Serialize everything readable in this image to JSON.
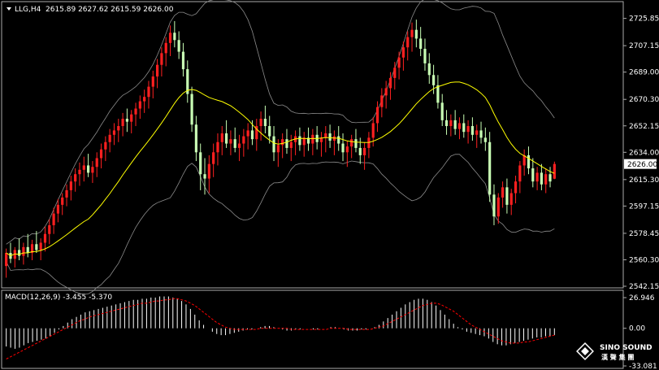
{
  "colors": {
    "background": "#000000",
    "bull": "#ff2020",
    "bear": "#c8ffb4",
    "ma": "#ffff00",
    "band": "#8c8c8c",
    "macd_hist": "#ffffff",
    "macd_signal": "#ff0000",
    "text": "#ffffff"
  },
  "header": {
    "symbol": "LLG,H4",
    "ohlc": "2615.89 2627.62 2615.59 2626.00",
    "menu_icon": "triangle-down-icon"
  },
  "price_axis": {
    "ticks": [
      "2725.85",
      "2707.15",
      "2689.00",
      "2670.30",
      "2652.15",
      "2634.00",
      "2615.30",
      "2597.15",
      "2578.45",
      "2560.30",
      "2542.15"
    ],
    "current_price": "2626.00"
  },
  "macd": {
    "label": "MACD(12,26,9) -3.455 -5.370",
    "ticks": [
      "26.946",
      "0.00",
      "-33.081"
    ]
  },
  "watermark": {
    "brand": "SINO SOUND",
    "chinese": "漢 聲 集 團",
    "icon": "sino-sound-diamond-icon"
  },
  "chart_data": {
    "type": "candlestick",
    "title": "LLG,H4",
    "ylim": [
      2542.15,
      2734
    ],
    "candles": [
      [
        2556,
        2568,
        2548,
        2565
      ],
      [
        2565,
        2572,
        2558,
        2561
      ],
      [
        2561,
        2569,
        2555,
        2567
      ],
      [
        2567,
        2575,
        2560,
        2563
      ],
      [
        2563,
        2572,
        2557,
        2569
      ],
      [
        2569,
        2578,
        2562,
        2565
      ],
      [
        2565,
        2574,
        2560,
        2571
      ],
      [
        2571,
        2580,
        2565,
        2567
      ],
      [
        2567,
        2575,
        2560,
        2572
      ],
      [
        2572,
        2583,
        2566,
        2578
      ],
      [
        2578,
        2588,
        2571,
        2584
      ],
      [
        2584,
        2596,
        2578,
        2592
      ],
      [
        2592,
        2602,
        2586,
        2598
      ],
      [
        2598,
        2606,
        2591,
        2603
      ],
      [
        2603,
        2612,
        2597,
        2608
      ],
      [
        2608,
        2618,
        2601,
        2614
      ],
      [
        2614,
        2623,
        2607,
        2619
      ],
      [
        2619,
        2627,
        2611,
        2622
      ],
      [
        2622,
        2631,
        2614,
        2625
      ],
      [
        2625,
        2633,
        2617,
        2620
      ],
      [
        2620,
        2628,
        2613,
        2624
      ],
      [
        2624,
        2634,
        2617,
        2630
      ],
      [
        2630,
        2640,
        2623,
        2636
      ],
      [
        2636,
        2645,
        2628,
        2641
      ],
      [
        2641,
        2650,
        2634,
        2646
      ],
      [
        2646,
        2654,
        2639,
        2649
      ],
      [
        2649,
        2657,
        2641,
        2652
      ],
      [
        2652,
        2661,
        2645,
        2657
      ],
      [
        2657,
        2664,
        2648,
        2655
      ],
      [
        2655,
        2663,
        2647,
        2660
      ],
      [
        2660,
        2668,
        2652,
        2664
      ],
      [
        2664,
        2673,
        2657,
        2669
      ],
      [
        2669,
        2677,
        2661,
        2672
      ],
      [
        2672,
        2683,
        2664,
        2679
      ],
      [
        2679,
        2690,
        2671,
        2686
      ],
      [
        2686,
        2698,
        2678,
        2694
      ],
      [
        2694,
        2706,
        2686,
        2702
      ],
      [
        2702,
        2713,
        2693,
        2709
      ],
      [
        2709,
        2721,
        2700,
        2716
      ],
      [
        2716,
        2724,
        2706,
        2711
      ],
      [
        2711,
        2717,
        2698,
        2703
      ],
      [
        2703,
        2709,
        2686,
        2691
      ],
      [
        2691,
        2697,
        2668,
        2674
      ],
      [
        2674,
        2679,
        2648,
        2653
      ],
      [
        2653,
        2659,
        2628,
        2634
      ],
      [
        2634,
        2640,
        2608,
        2619
      ],
      [
        2619,
        2630,
        2605,
        2616
      ],
      [
        2616,
        2632,
        2606,
        2626
      ],
      [
        2626,
        2640,
        2617,
        2634
      ],
      [
        2634,
        2647,
        2625,
        2641
      ],
      [
        2641,
        2652,
        2632,
        2647
      ],
      [
        2647,
        2656,
        2637,
        2640
      ],
      [
        2640,
        2649,
        2632,
        2643
      ],
      [
        2643,
        2651,
        2634,
        2637
      ],
      [
        2637,
        2646,
        2628,
        2640
      ],
      [
        2640,
        2650,
        2631,
        2645
      ],
      [
        2645,
        2654,
        2636,
        2649
      ],
      [
        2649,
        2656,
        2639,
        2643
      ],
      [
        2643,
        2657,
        2635,
        2652
      ],
      [
        2652,
        2662,
        2642,
        2657
      ],
      [
        2657,
        2666,
        2647,
        2652
      ],
      [
        2652,
        2659,
        2640,
        2645
      ],
      [
        2645,
        2652,
        2628,
        2634
      ],
      [
        2634,
        2643,
        2624,
        2639
      ],
      [
        2639,
        2647,
        2630,
        2643
      ],
      [
        2643,
        2650,
        2633,
        2637
      ],
      [
        2637,
        2646,
        2628,
        2641
      ],
      [
        2641,
        2649,
        2632,
        2645
      ],
      [
        2645,
        2651,
        2635,
        2639
      ],
      [
        2639,
        2648,
        2631,
        2644
      ],
      [
        2644,
        2651,
        2635,
        2640
      ],
      [
        2640,
        2650,
        2632,
        2646
      ],
      [
        2646,
        2652,
        2636,
        2641
      ],
      [
        2641,
        2648,
        2631,
        2644
      ],
      [
        2644,
        2652,
        2634,
        2647
      ],
      [
        2647,
        2653,
        2637,
        2642
      ],
      [
        2642,
        2649,
        2632,
        2645
      ],
      [
        2645,
        2652,
        2635,
        2640
      ],
      [
        2640,
        2647,
        2628,
        2634
      ],
      [
        2634,
        2642,
        2624,
        2638
      ],
      [
        2638,
        2646,
        2630,
        2643
      ],
      [
        2643,
        2650,
        2634,
        2637
      ],
      [
        2637,
        2644,
        2626,
        2632
      ],
      [
        2632,
        2641,
        2622,
        2637
      ],
      [
        2637,
        2648,
        2630,
        2644
      ],
      [
        2644,
        2658,
        2638,
        2654
      ],
      [
        2654,
        2669,
        2648,
        2665
      ],
      [
        2665,
        2678,
        2658,
        2673
      ],
      [
        2673,
        2683,
        2664,
        2678
      ],
      [
        2678,
        2689,
        2670,
        2685
      ],
      [
        2685,
        2696,
        2677,
        2692
      ],
      [
        2692,
        2703,
        2684,
        2699
      ],
      [
        2699,
        2710,
        2690,
        2706
      ],
      [
        2706,
        2717,
        2697,
        2713
      ],
      [
        2713,
        2723,
        2703,
        2718
      ],
      [
        2718,
        2725,
        2706,
        2712
      ],
      [
        2712,
        2720,
        2700,
        2705
      ],
      [
        2705,
        2712,
        2690,
        2695
      ],
      [
        2695,
        2702,
        2681,
        2687
      ],
      [
        2687,
        2694,
        2674,
        2680
      ],
      [
        2680,
        2687,
        2664,
        2668
      ],
      [
        2668,
        2674,
        2652,
        2656
      ],
      [
        2656,
        2663,
        2646,
        2652
      ],
      [
        2652,
        2660,
        2645,
        2656
      ],
      [
        2656,
        2663,
        2646,
        2650
      ],
      [
        2650,
        2658,
        2643,
        2654
      ],
      [
        2654,
        2660,
        2644,
        2648
      ],
      [
        2648,
        2656,
        2640,
        2652
      ],
      [
        2652,
        2658,
        2642,
        2646
      ],
      [
        2646,
        2653,
        2637,
        2649
      ],
      [
        2649,
        2655,
        2640,
        2644
      ],
      [
        2644,
        2651,
        2635,
        2641
      ],
      [
        2641,
        2648,
        2600,
        2605
      ],
      [
        2605,
        2612,
        2584,
        2590
      ],
      [
        2590,
        2606,
        2585,
        2603
      ],
      [
        2603,
        2614,
        2596,
        2610
      ],
      [
        2610,
        2616,
        2592,
        2598
      ],
      [
        2598,
        2609,
        2591,
        2606
      ],
      [
        2606,
        2618,
        2599,
        2614
      ],
      [
        2614,
        2628,
        2606,
        2625
      ],
      [
        2625,
        2636,
        2618,
        2632
      ],
      [
        2632,
        2638,
        2619,
        2623
      ],
      [
        2623,
        2630,
        2610,
        2614
      ],
      [
        2614,
        2624,
        2608,
        2620
      ],
      [
        2620,
        2626,
        2608,
        2612
      ],
      [
        2612,
        2623,
        2606,
        2619
      ],
      [
        2619,
        2624,
        2610,
        2614
      ],
      [
        2615.89,
        2627.62,
        2615.59,
        2626
      ]
    ],
    "macd_histogram": [
      -16,
      -17,
      -18,
      -17,
      -15,
      -13,
      -12,
      -11,
      -10,
      -9,
      -7,
      -4,
      -1,
      2,
      5,
      8,
      10,
      12,
      14,
      15,
      16,
      17,
      18,
      19,
      20,
      21,
      22,
      23,
      24,
      25,
      25,
      26,
      26,
      27,
      27,
      28,
      28,
      28,
      27,
      26,
      24,
      21,
      17,
      12,
      7,
      3,
      0,
      -3,
      -5,
      -6,
      -6,
      -5,
      -4,
      -3,
      -2,
      -1,
      -1,
      0,
      1,
      2,
      2,
      1,
      0,
      -1,
      -2,
      -2,
      -1,
      -1,
      0,
      0,
      -1,
      -1,
      0,
      0,
      1,
      1,
      0,
      -1,
      -2,
      -2,
      -2,
      -1,
      -1,
      0,
      1,
      3,
      6,
      9,
      12,
      15,
      18,
      21,
      23,
      25,
      26,
      26,
      25,
      23,
      20,
      16,
      12,
      8,
      4,
      1,
      -1,
      -3,
      -4,
      -5,
      -6,
      -7,
      -9,
      -12,
      -14,
      -15,
      -15,
      -14,
      -13,
      -12,
      -11,
      -10,
      -9,
      -8,
      -8,
      -7,
      -7,
      -6
    ],
    "macd_signal": [
      -27,
      -25,
      -23,
      -21,
      -19,
      -17,
      -15,
      -13,
      -11,
      -9,
      -7,
      -5,
      -3,
      -1,
      1,
      3,
      5,
      7,
      8,
      10,
      11,
      12,
      13,
      14,
      15,
      16,
      17,
      18,
      19,
      20,
      21,
      22,
      22,
      23,
      24,
      24,
      25,
      25,
      26,
      26,
      25,
      24,
      22,
      20,
      17,
      14,
      11,
      8,
      5,
      3,
      1,
      0,
      -1,
      -1,
      -1,
      -1,
      -1,
      -1,
      0,
      0,
      0,
      0,
      0,
      0,
      0,
      -1,
      -1,
      -1,
      -1,
      -1,
      -1,
      -1,
      -1,
      -1,
      0,
      0,
      0,
      0,
      -1,
      -1,
      -1,
      -1,
      -1,
      -1,
      0,
      1,
      2,
      4,
      6,
      8,
      10,
      12,
      14,
      16,
      18,
      20,
      21,
      22,
      22,
      21,
      19,
      17,
      15,
      12,
      9,
      6,
      3,
      1,
      -1,
      -3,
      -5,
      -7,
      -9,
      -11,
      -12,
      -13,
      -13,
      -13,
      -12,
      -12,
      -11,
      -10,
      -9,
      -8,
      -7,
      -6
    ],
    "macd_ylim": [
      -33.081,
      26.946
    ]
  }
}
